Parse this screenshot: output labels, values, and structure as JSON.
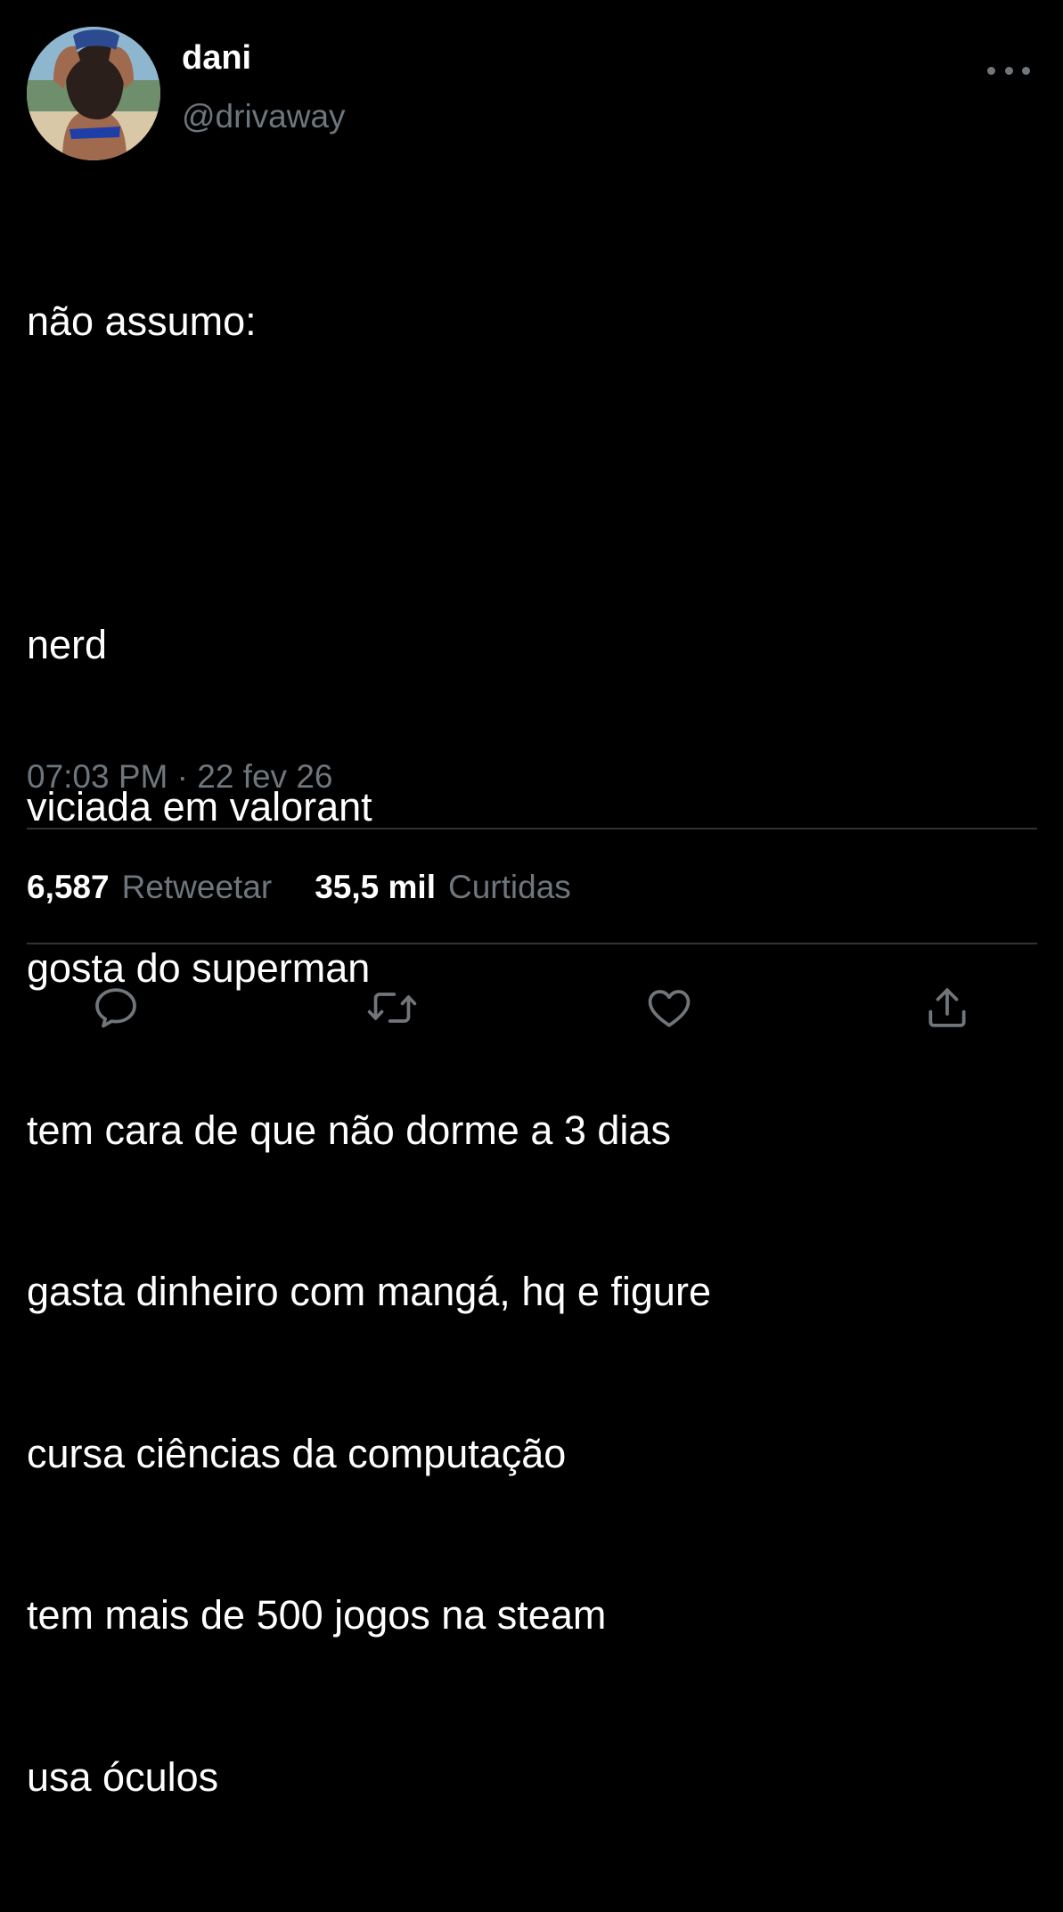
{
  "author": {
    "name": "dani",
    "handle": "@drivaway"
  },
  "tweet": {
    "lines": [
      "não assumo:",
      "",
      "nerd",
      "viciada em valorant",
      "gosta do superman",
      "tem cara de que não dorme a 3 dias",
      "gasta dinheiro com mangá, hq e figure",
      "cursa ciências da computação",
      "tem mais de 500 jogos na steam",
      "usa óculos"
    ],
    "timestamp": "07:03 PM · 22 fev 26"
  },
  "stats": {
    "retweets_count": "6,587",
    "retweets_label": "Retweetar",
    "likes_count": "35,5 mil",
    "likes_label": "Curtidas"
  },
  "actions": {
    "reply_icon": "reply-icon",
    "retweet_icon": "retweet-icon",
    "like_icon": "heart-icon",
    "share_icon": "share-icon"
  },
  "colors": {
    "background": "#000000",
    "text": "#ffffff",
    "secondary": "#6e767d",
    "divider": "#2f3336"
  }
}
